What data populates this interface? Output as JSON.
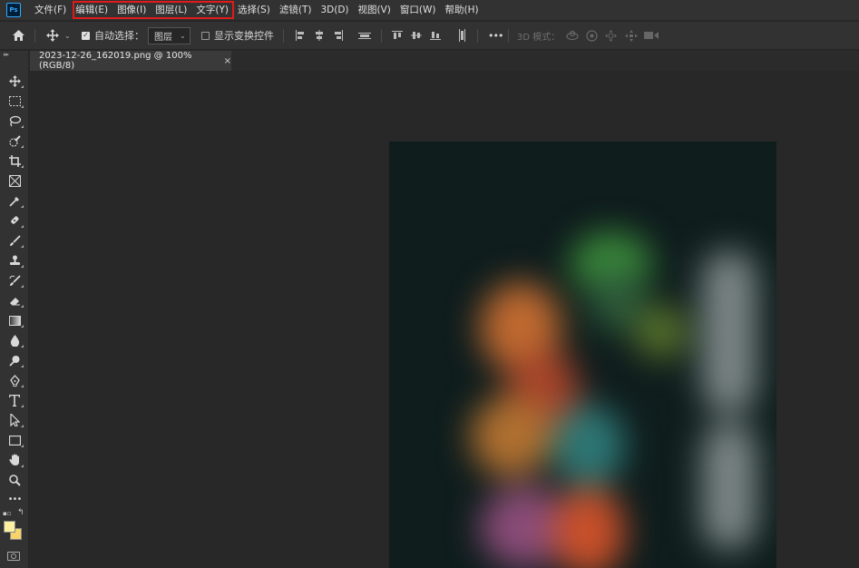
{
  "app": {
    "logo": "Ps"
  },
  "menu": [
    "文件(F)",
    "编辑(E)",
    "图像(I)",
    "图层(L)",
    "文字(Y)",
    "选择(S)",
    "滤镜(T)",
    "3D(D)",
    "视图(V)",
    "窗口(W)",
    "帮助(H)"
  ],
  "options": {
    "auto_select_label": "自动选择：",
    "auto_select_checked": true,
    "auto_select_value": "图层",
    "show_transform_label": "显示变换控件",
    "show_transform_checked": false,
    "more": "•••",
    "mode_3d_label": "3D 模式："
  },
  "document": {
    "tab_title": "2023-12-26_162019.png @ 100%(RGB/8)",
    "close_glyph": "×"
  },
  "colors": {
    "foreground": "#fdf1a0",
    "background": "#f6d46b",
    "highlight": "#e01b1b"
  }
}
